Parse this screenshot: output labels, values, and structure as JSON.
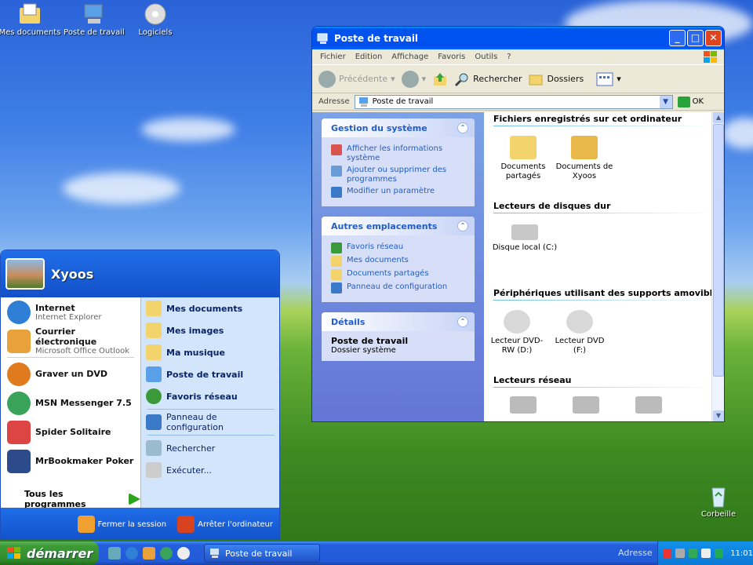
{
  "desktop": {
    "icons": [
      {
        "label": "Mes documents",
        "icon": "folder-documents-icon"
      },
      {
        "label": "Poste de travail",
        "icon": "computer-icon"
      },
      {
        "label": "Logiciels",
        "icon": "software-cd-icon"
      }
    ],
    "recycle_bin": "Corbeille"
  },
  "start_menu": {
    "user": "Xyoos",
    "pinned": [
      {
        "title": "Internet",
        "subtitle": "Internet Explorer"
      },
      {
        "title": "Courrier électronique",
        "subtitle": "Microsoft Office Outlook"
      }
    ],
    "recent": [
      "Graver un DVD",
      "MSN Messenger 7.5",
      "Spider Solitaire",
      "MrBookmaker Poker"
    ],
    "all_programs": "Tous les programmes",
    "places": [
      "Mes documents",
      "Mes images",
      "Ma musique",
      "Poste de travail",
      "Favoris réseau"
    ],
    "system": [
      "Panneau de configuration",
      "Rechercher",
      "Exécuter..."
    ],
    "logoff": "Fermer la session",
    "shutdown": "Arrêter l'ordinateur"
  },
  "taskbar": {
    "start_label": "démarrer",
    "task": "Poste de travail",
    "address_label": "Adresse",
    "clock": "11:01"
  },
  "window": {
    "title": "Poste de travail",
    "menu": [
      "Fichier",
      "Edition",
      "Affichage",
      "Favoris",
      "Outils",
      "?"
    ],
    "toolbar": {
      "back": "Précédente",
      "search": "Rechercher",
      "folders": "Dossiers"
    },
    "address_label": "Adresse",
    "address_value": "Poste de travail",
    "go_label": "OK",
    "taskpane": {
      "system": {
        "title": "Gestion du système",
        "links": [
          "Afficher les informations système",
          "Ajouter ou supprimer des programmes",
          "Modifier un paramètre"
        ]
      },
      "places": {
        "title": "Autres emplacements",
        "links": [
          "Favoris réseau",
          "Mes documents",
          "Documents partagés",
          "Panneau de configuration"
        ]
      },
      "details": {
        "title": "Détails",
        "name": "Poste de travail",
        "kind": "Dossier système"
      }
    },
    "sections": {
      "files": {
        "title": "Fichiers enregistrés sur cet ordinateur",
        "items": [
          "Documents partagés",
          "Documents de Xyoos"
        ]
      },
      "hdd": {
        "title": "Lecteurs de disques dur",
        "items": [
          "Disque local (C:)"
        ]
      },
      "removable": {
        "title": "Périphériques utilisant des supports amovibles",
        "items": [
          "Lecteur DVD-RW (D:)",
          "Lecteur DVD (F:)"
        ]
      },
      "network": {
        "title": "Lecteurs réseau",
        "items": [
          "",
          "",
          ""
        ]
      }
    }
  },
  "colors": {
    "xp_blue": "#0054e3",
    "start_green": "#3c9b37",
    "link_blue": "#215dc6"
  }
}
